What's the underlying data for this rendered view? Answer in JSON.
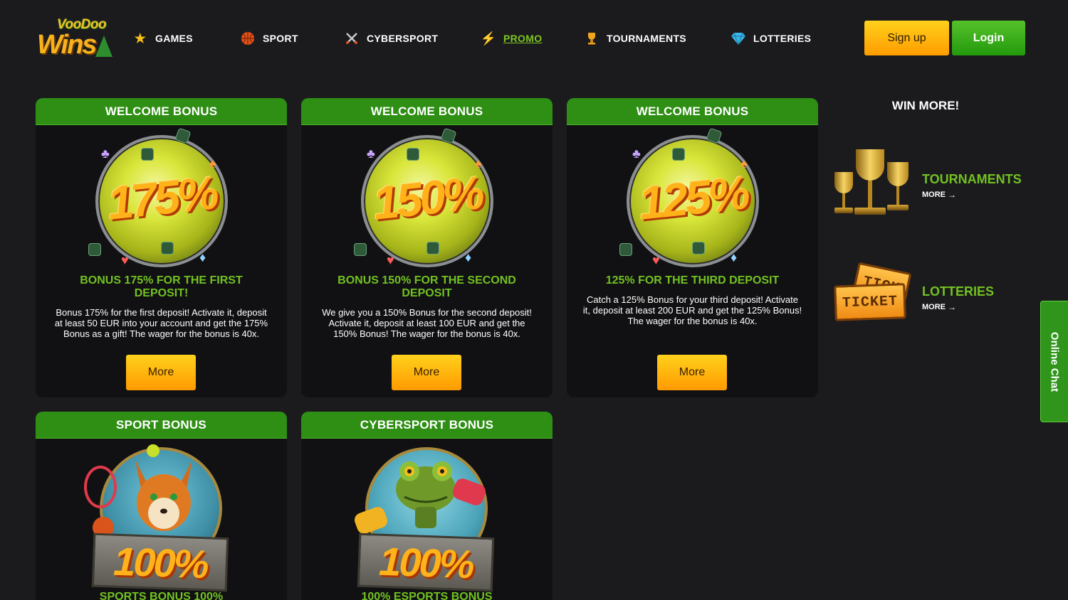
{
  "logo": {
    "top_text": "VooDoo",
    "main_text": "Wins"
  },
  "nav": [
    {
      "label": "GAMES",
      "icon": "star-icon"
    },
    {
      "label": "SPORT",
      "icon": "basketball-icon"
    },
    {
      "label": "CYBERSPORT",
      "icon": "crossed-swords-icon"
    },
    {
      "label": "PROMO",
      "icon": "lightning-icon",
      "active": true
    },
    {
      "label": "TOURNAMENTS",
      "icon": "trophy-icon"
    },
    {
      "label": "LOTTERIES",
      "icon": "diamond-icon"
    }
  ],
  "auth": {
    "signup_label": "Sign up",
    "login_label": "Login"
  },
  "cards": [
    {
      "header": "WELCOME BONUS",
      "percent": "175%",
      "title": "BONUS 175% FOR THE FIRST DEPOSIT!",
      "description": "Bonus 175% for the first deposit! Activate it, deposit at least 50 EUR into your account and get the 175% Bonus as a gift! The wager for the bonus is 40x.",
      "button": "More"
    },
    {
      "header": "WELCOME BONUS",
      "percent": "150%",
      "title": "BONUS 150% FOR THE SECOND DEPOSIT",
      "description": "We give you a 150% Bonus for the second deposit! Activate it, deposit at least 100 EUR and get the 150% Bonus! The wager for the bonus is 40x.",
      "button": "More"
    },
    {
      "header": "WELCOME BONUS",
      "percent": "125%",
      "title": "125% FOR THE THIRD DEPOSIT",
      "description": "Catch a 125% Bonus for your third deposit! Activate it, deposit at least 200 EUR and get the 125% Bonus! The wager for the bonus is 40x.",
      "button": "More"
    },
    {
      "header": "SPORT BONUS",
      "percent": "100%",
      "title": "SPORTS BONUS 100%"
    },
    {
      "header": "CYBERSPORT BONUS",
      "percent": "100%",
      "title": "100% ESPORTS BONUS"
    }
  ],
  "sidebar": {
    "heading": "WIN MORE!",
    "items": [
      {
        "label": "TOURNAMENTS",
        "more": "MORE",
        "icon": "trophies-icon"
      },
      {
        "label": "LOTTERIES",
        "more": "MORE",
        "icon": "tickets-icon"
      }
    ]
  },
  "online_chat": "Online Chat",
  "colors": {
    "accent_green": "#2e8f14",
    "title_green": "#72c121",
    "button_yellow": "#ffb800",
    "background": "#1b1b1e"
  }
}
